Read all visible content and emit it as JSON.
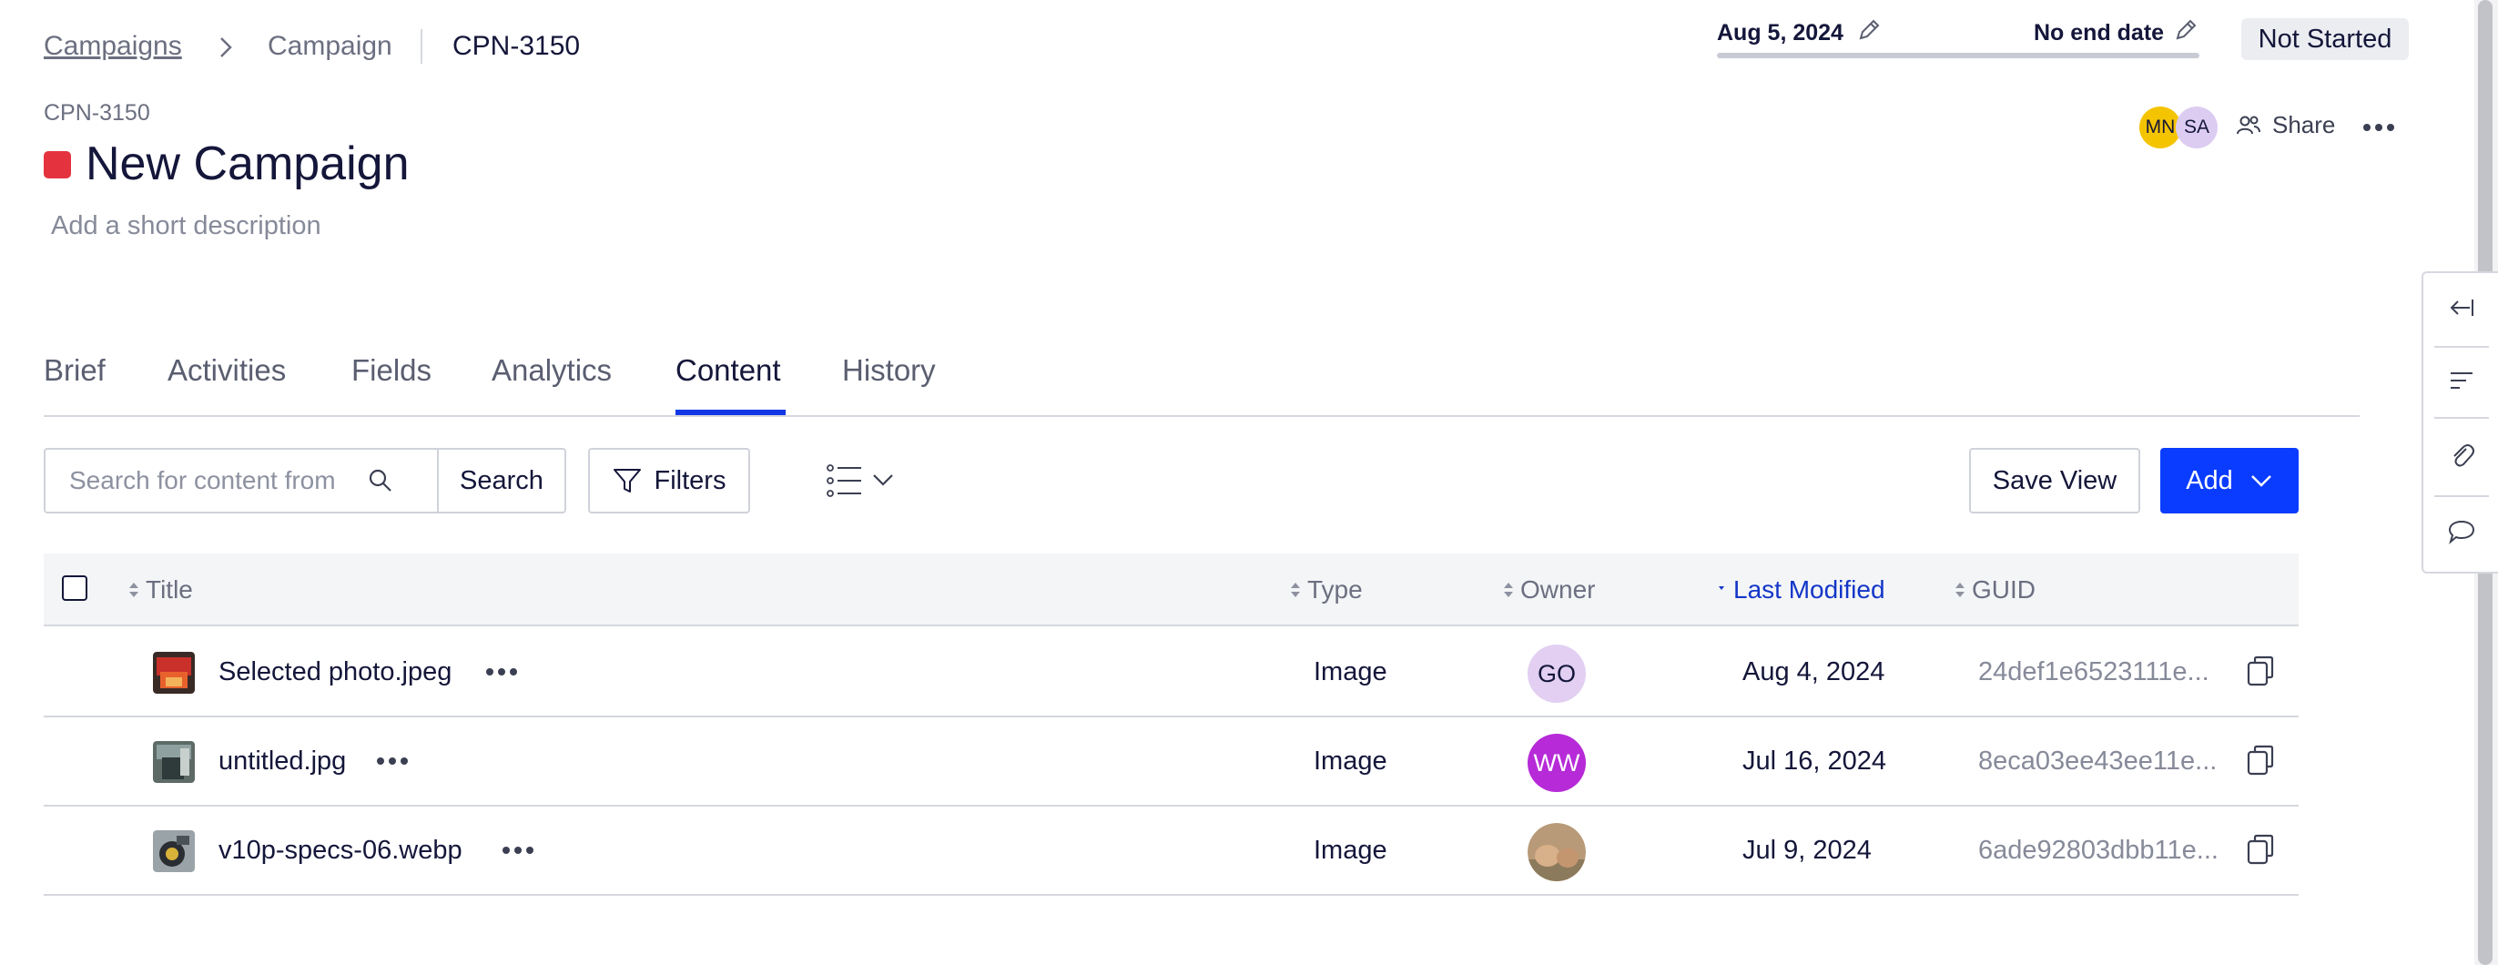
{
  "breadcrumb": {
    "root": "Campaigns",
    "middle": "Campaign",
    "current": "CPN-3150"
  },
  "dates": {
    "start": "Aug 5, 2024",
    "end": "No end date"
  },
  "status": "Not Started",
  "header": {
    "id": "CPN-3150",
    "title": "New Campaign",
    "description_placeholder": "Add a short description",
    "color": "#e5323f",
    "avatars": [
      {
        "initials": "MN",
        "color": "#f5c400"
      },
      {
        "initials": "SA",
        "color": "#dcccf1"
      }
    ],
    "share_label": "Share"
  },
  "tabs": [
    {
      "label": "Brief",
      "active": false
    },
    {
      "label": "Activities",
      "active": false
    },
    {
      "label": "Fields",
      "active": false
    },
    {
      "label": "Analytics",
      "active": false
    },
    {
      "label": "Content",
      "active": true
    },
    {
      "label": "History",
      "active": false
    }
  ],
  "toolbar": {
    "search_placeholder": "Search for content from",
    "search_label": "Search",
    "filters_label": "Filters",
    "save_view_label": "Save View",
    "add_label": "Add"
  },
  "table": {
    "columns": [
      "Title",
      "Type",
      "Owner",
      "Last Modified",
      "GUID"
    ],
    "sorted_column": "Last Modified",
    "rows": [
      {
        "title": "Selected photo.jpeg",
        "type": "Image",
        "owner": "GO",
        "owner_color": "#e2cff2",
        "owner_text_color": "#14163a",
        "modified": "Aug 4, 2024",
        "guid": "24def1e6523111e..."
      },
      {
        "title": "untitled.jpg",
        "type": "Image",
        "owner": "WW",
        "owner_color": "#b62ad8",
        "owner_text_color": "#ffffff",
        "modified": "Jul 16, 2024",
        "guid": "8eca03ee43ee11e..."
      },
      {
        "title": "v10p-specs-06.webp",
        "type": "Image",
        "owner": "",
        "owner_color": "#b89a78",
        "owner_text_color": "#ffffff",
        "modified": "Jul 9, 2024",
        "guid": "6ade92803dbb11e..."
      }
    ]
  },
  "colors": {
    "accent": "#0a3cff",
    "sorted_header": "#1236c8",
    "tab_underline": "#1236e6"
  },
  "icons": [
    "chevron-right-icon",
    "pencil-icon",
    "share-people-icon",
    "more-dots-icon",
    "search-icon",
    "filter-icon",
    "list-view-icon",
    "chevron-down-icon",
    "sort-icon",
    "copy-icon",
    "collapse-left-icon",
    "outline-icon",
    "attachment-icon",
    "comment-icon"
  ]
}
